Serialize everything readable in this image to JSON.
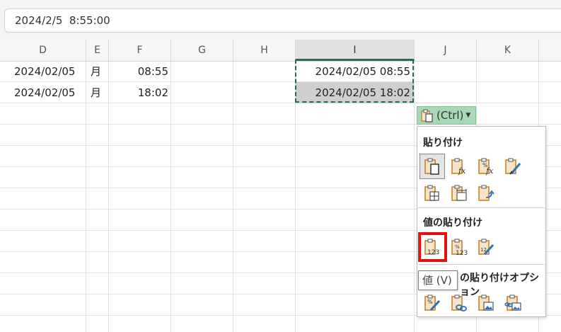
{
  "formula_bar": {
    "value": "2024/2/5  8:55:00"
  },
  "columns": [
    "D",
    "E",
    "F",
    "G",
    "H",
    "I",
    "J",
    "K"
  ],
  "rows": [
    {
      "d": "2024/02/05",
      "e": "月",
      "f": "08:55",
      "i": "2024/02/05 08:55"
    },
    {
      "d": "2024/02/05",
      "e": "月",
      "f": "18:02",
      "i": "2024/02/05 18:02"
    }
  ],
  "paste_button": {
    "label": "(Ctrl)",
    "icon": "clipboard-icon"
  },
  "paste_menu": {
    "section_paste": "貼り付け",
    "section_values": "値の貼り付け",
    "section_other": "の貼り付けオプション",
    "paste_items": [
      {
        "icon": "paste-icon"
      },
      {
        "icon": "paste-formulas-icon"
      },
      {
        "icon": "paste-formulas-number-format-icon"
      },
      {
        "icon": "paste-keep-source-formatting-icon"
      },
      {
        "icon": "paste-no-borders-icon"
      },
      {
        "icon": "paste-keep-column-widths-icon"
      },
      {
        "icon": "paste-transpose-icon"
      }
    ],
    "value_items": [
      {
        "icon": "paste-values-icon"
      },
      {
        "icon": "paste-values-number-format-icon"
      },
      {
        "icon": "paste-values-source-formatting-icon"
      }
    ],
    "other_items": [
      {
        "icon": "paste-formatting-icon"
      },
      {
        "icon": "paste-link-icon"
      },
      {
        "icon": "paste-picture-icon"
      },
      {
        "icon": "paste-linked-picture-icon"
      }
    ]
  },
  "tooltip": {
    "text": "値 (V)"
  },
  "colors": {
    "selection_border": "#1e7145",
    "highlight": "#e21010",
    "paste_button_bg": "#a9d8b5"
  }
}
